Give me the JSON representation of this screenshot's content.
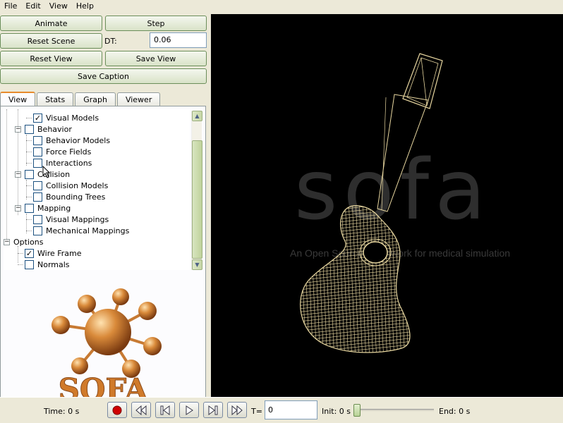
{
  "menu": [
    "File",
    "Edit",
    "View",
    "Help"
  ],
  "controls": {
    "animate": "Animate",
    "step": "Step",
    "reset_scene": "Reset Scene",
    "dt_label": "DT:",
    "dt_value": "0.06",
    "reset_view": "Reset View",
    "save_view": "Save View",
    "save_caption": "Save Caption"
  },
  "tabs": [
    "View",
    "Stats",
    "Graph",
    "Viewer"
  ],
  "tree": {
    "visual_models": {
      "label": "Visual Models",
      "checked": true
    },
    "behavior": {
      "label": "Behavior",
      "checked": false
    },
    "behavior_models": {
      "label": "Behavior Models",
      "checked": false
    },
    "force_fields": {
      "label": "Force Fields",
      "checked": false
    },
    "interactions": {
      "label": "Interactions",
      "checked": false
    },
    "collision": {
      "label": "Collision",
      "checked": false
    },
    "collision_models": {
      "label": "Collision Models",
      "checked": false
    },
    "bounding_trees": {
      "label": "Bounding Trees",
      "checked": false
    },
    "mapping": {
      "label": "Mapping",
      "checked": false
    },
    "visual_mappings": {
      "label": "Visual Mappings",
      "checked": false
    },
    "mechanical_mappings": {
      "label": "Mechanical Mappings",
      "checked": false
    },
    "options": {
      "label": "Options"
    },
    "wire_frame": {
      "label": "Wire Frame",
      "checked": true
    },
    "normals": {
      "label": "Normals",
      "checked": false
    },
    "check_mark": "✓"
  },
  "logo_text": "SOFA",
  "viewer": {
    "watermark_big": "sofa",
    "watermark_sub": "An Open Source framework for medical simulation"
  },
  "bottom": {
    "time_label": "Time: 0 s",
    "t_label": "T=",
    "t_value": "0",
    "init_label": "Init: 0 s",
    "end_label": "End: 0 s"
  },
  "colors": {
    "wire": "#e8d7a0",
    "record": "#d00000",
    "logo_orange": "#d9832e"
  }
}
